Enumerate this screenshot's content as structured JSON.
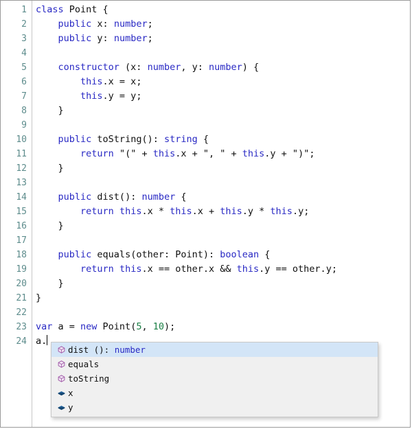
{
  "editor": {
    "language": "typescript",
    "colors": {
      "keyword": "#2929c4",
      "number": "#1a7f45",
      "plain": "#101010",
      "gutter_text": "#5d8c8c",
      "popup_bg": "#f0f0f0",
      "popup_selected_bg": "#d3e5f7",
      "method_icon": "#a05aa8",
      "property_icon": "#1f5f99"
    },
    "gutter": {
      "line_numbers": [
        "1",
        "2",
        "3",
        "4",
        "5",
        "6",
        "7",
        "8",
        "9",
        "10",
        "11",
        "12",
        "13",
        "14",
        "15",
        "16",
        "17",
        "18",
        "19",
        "20",
        "21",
        "22",
        "23",
        "24"
      ]
    },
    "lines": [
      {
        "n": 1,
        "tokens": [
          {
            "t": "class",
            "c": "kw"
          },
          {
            "t": " Point {",
            "c": "plain"
          }
        ]
      },
      {
        "n": 2,
        "tokens": [
          {
            "t": "    ",
            "c": "plain"
          },
          {
            "t": "public",
            "c": "kw"
          },
          {
            "t": " x: ",
            "c": "plain"
          },
          {
            "t": "number",
            "c": "kw"
          },
          {
            "t": ";",
            "c": "plain"
          }
        ]
      },
      {
        "n": 3,
        "tokens": [
          {
            "t": "    ",
            "c": "plain"
          },
          {
            "t": "public",
            "c": "kw"
          },
          {
            "t": " y: ",
            "c": "plain"
          },
          {
            "t": "number",
            "c": "kw"
          },
          {
            "t": ";",
            "c": "plain"
          }
        ]
      },
      {
        "n": 4,
        "tokens": [
          {
            "t": "",
            "c": "plain"
          }
        ]
      },
      {
        "n": 5,
        "tokens": [
          {
            "t": "    ",
            "c": "plain"
          },
          {
            "t": "constructor",
            "c": "kw"
          },
          {
            "t": " (x: ",
            "c": "plain"
          },
          {
            "t": "number",
            "c": "kw"
          },
          {
            "t": ", y: ",
            "c": "plain"
          },
          {
            "t": "number",
            "c": "kw"
          },
          {
            "t": ") {",
            "c": "plain"
          }
        ]
      },
      {
        "n": 6,
        "tokens": [
          {
            "t": "        ",
            "c": "plain"
          },
          {
            "t": "this",
            "c": "kw"
          },
          {
            "t": ".x = x;",
            "c": "plain"
          }
        ]
      },
      {
        "n": 7,
        "tokens": [
          {
            "t": "        ",
            "c": "plain"
          },
          {
            "t": "this",
            "c": "kw"
          },
          {
            "t": ".y = y;",
            "c": "plain"
          }
        ]
      },
      {
        "n": 8,
        "tokens": [
          {
            "t": "    }",
            "c": "plain"
          }
        ]
      },
      {
        "n": 9,
        "tokens": [
          {
            "t": "",
            "c": "plain"
          }
        ]
      },
      {
        "n": 10,
        "tokens": [
          {
            "t": "    ",
            "c": "plain"
          },
          {
            "t": "public",
            "c": "kw"
          },
          {
            "t": " toString(): ",
            "c": "plain"
          },
          {
            "t": "string",
            "c": "kw"
          },
          {
            "t": " {",
            "c": "plain"
          }
        ]
      },
      {
        "n": 11,
        "tokens": [
          {
            "t": "        ",
            "c": "plain"
          },
          {
            "t": "return",
            "c": "kw"
          },
          {
            "t": " \"(\" + ",
            "c": "plain"
          },
          {
            "t": "this",
            "c": "kw"
          },
          {
            "t": ".x + \", \" + ",
            "c": "plain"
          },
          {
            "t": "this",
            "c": "kw"
          },
          {
            "t": ".y + \")\";",
            "c": "plain"
          }
        ]
      },
      {
        "n": 12,
        "tokens": [
          {
            "t": "    }",
            "c": "plain"
          }
        ]
      },
      {
        "n": 13,
        "tokens": [
          {
            "t": "",
            "c": "plain"
          }
        ]
      },
      {
        "n": 14,
        "tokens": [
          {
            "t": "    ",
            "c": "plain"
          },
          {
            "t": "public",
            "c": "kw"
          },
          {
            "t": " dist(): ",
            "c": "plain"
          },
          {
            "t": "number",
            "c": "kw"
          },
          {
            "t": " {",
            "c": "plain"
          }
        ]
      },
      {
        "n": 15,
        "tokens": [
          {
            "t": "        ",
            "c": "plain"
          },
          {
            "t": "return",
            "c": "kw"
          },
          {
            "t": " ",
            "c": "plain"
          },
          {
            "t": "this",
            "c": "kw"
          },
          {
            "t": ".x * ",
            "c": "plain"
          },
          {
            "t": "this",
            "c": "kw"
          },
          {
            "t": ".x + ",
            "c": "plain"
          },
          {
            "t": "this",
            "c": "kw"
          },
          {
            "t": ".y * ",
            "c": "plain"
          },
          {
            "t": "this",
            "c": "kw"
          },
          {
            "t": ".y;",
            "c": "plain"
          }
        ]
      },
      {
        "n": 16,
        "tokens": [
          {
            "t": "    }",
            "c": "plain"
          }
        ]
      },
      {
        "n": 17,
        "tokens": [
          {
            "t": "",
            "c": "plain"
          }
        ]
      },
      {
        "n": 18,
        "tokens": [
          {
            "t": "    ",
            "c": "plain"
          },
          {
            "t": "public",
            "c": "kw"
          },
          {
            "t": " equals(other: Point): ",
            "c": "plain"
          },
          {
            "t": "boolean",
            "c": "kw"
          },
          {
            "t": " {",
            "c": "plain"
          }
        ]
      },
      {
        "n": 19,
        "tokens": [
          {
            "t": "        ",
            "c": "plain"
          },
          {
            "t": "return",
            "c": "kw"
          },
          {
            "t": " ",
            "c": "plain"
          },
          {
            "t": "this",
            "c": "kw"
          },
          {
            "t": ".x == other.x && ",
            "c": "plain"
          },
          {
            "t": "this",
            "c": "kw"
          },
          {
            "t": ".y == other.y;",
            "c": "plain"
          }
        ]
      },
      {
        "n": 20,
        "tokens": [
          {
            "t": "    }",
            "c": "plain"
          }
        ]
      },
      {
        "n": 21,
        "tokens": [
          {
            "t": "}",
            "c": "plain"
          }
        ]
      },
      {
        "n": 22,
        "tokens": [
          {
            "t": "",
            "c": "plain"
          }
        ]
      },
      {
        "n": 23,
        "tokens": [
          {
            "t": "var",
            "c": "kw"
          },
          {
            "t": " a = ",
            "c": "plain"
          },
          {
            "t": "new",
            "c": "kw"
          },
          {
            "t": " Point(",
            "c": "plain"
          },
          {
            "t": "5",
            "c": "num"
          },
          {
            "t": ", ",
            "c": "plain"
          },
          {
            "t": "10",
            "c": "num"
          },
          {
            "t": ");",
            "c": "plain"
          }
        ]
      },
      {
        "n": 24,
        "tokens": [
          {
            "t": "a.",
            "c": "plain"
          }
        ],
        "caret": true
      }
    ]
  },
  "autocomplete": {
    "selected_index": 0,
    "items": [
      {
        "icon": "method-icon",
        "label": "dist",
        "signature": " ():",
        "type": " number"
      },
      {
        "icon": "method-icon",
        "label": "equals",
        "signature": "",
        "type": ""
      },
      {
        "icon": "method-icon",
        "label": "toString",
        "signature": "",
        "type": ""
      },
      {
        "icon": "property-icon",
        "label": "x",
        "signature": "",
        "type": ""
      },
      {
        "icon": "property-icon",
        "label": "y",
        "signature": "",
        "type": ""
      }
    ]
  }
}
